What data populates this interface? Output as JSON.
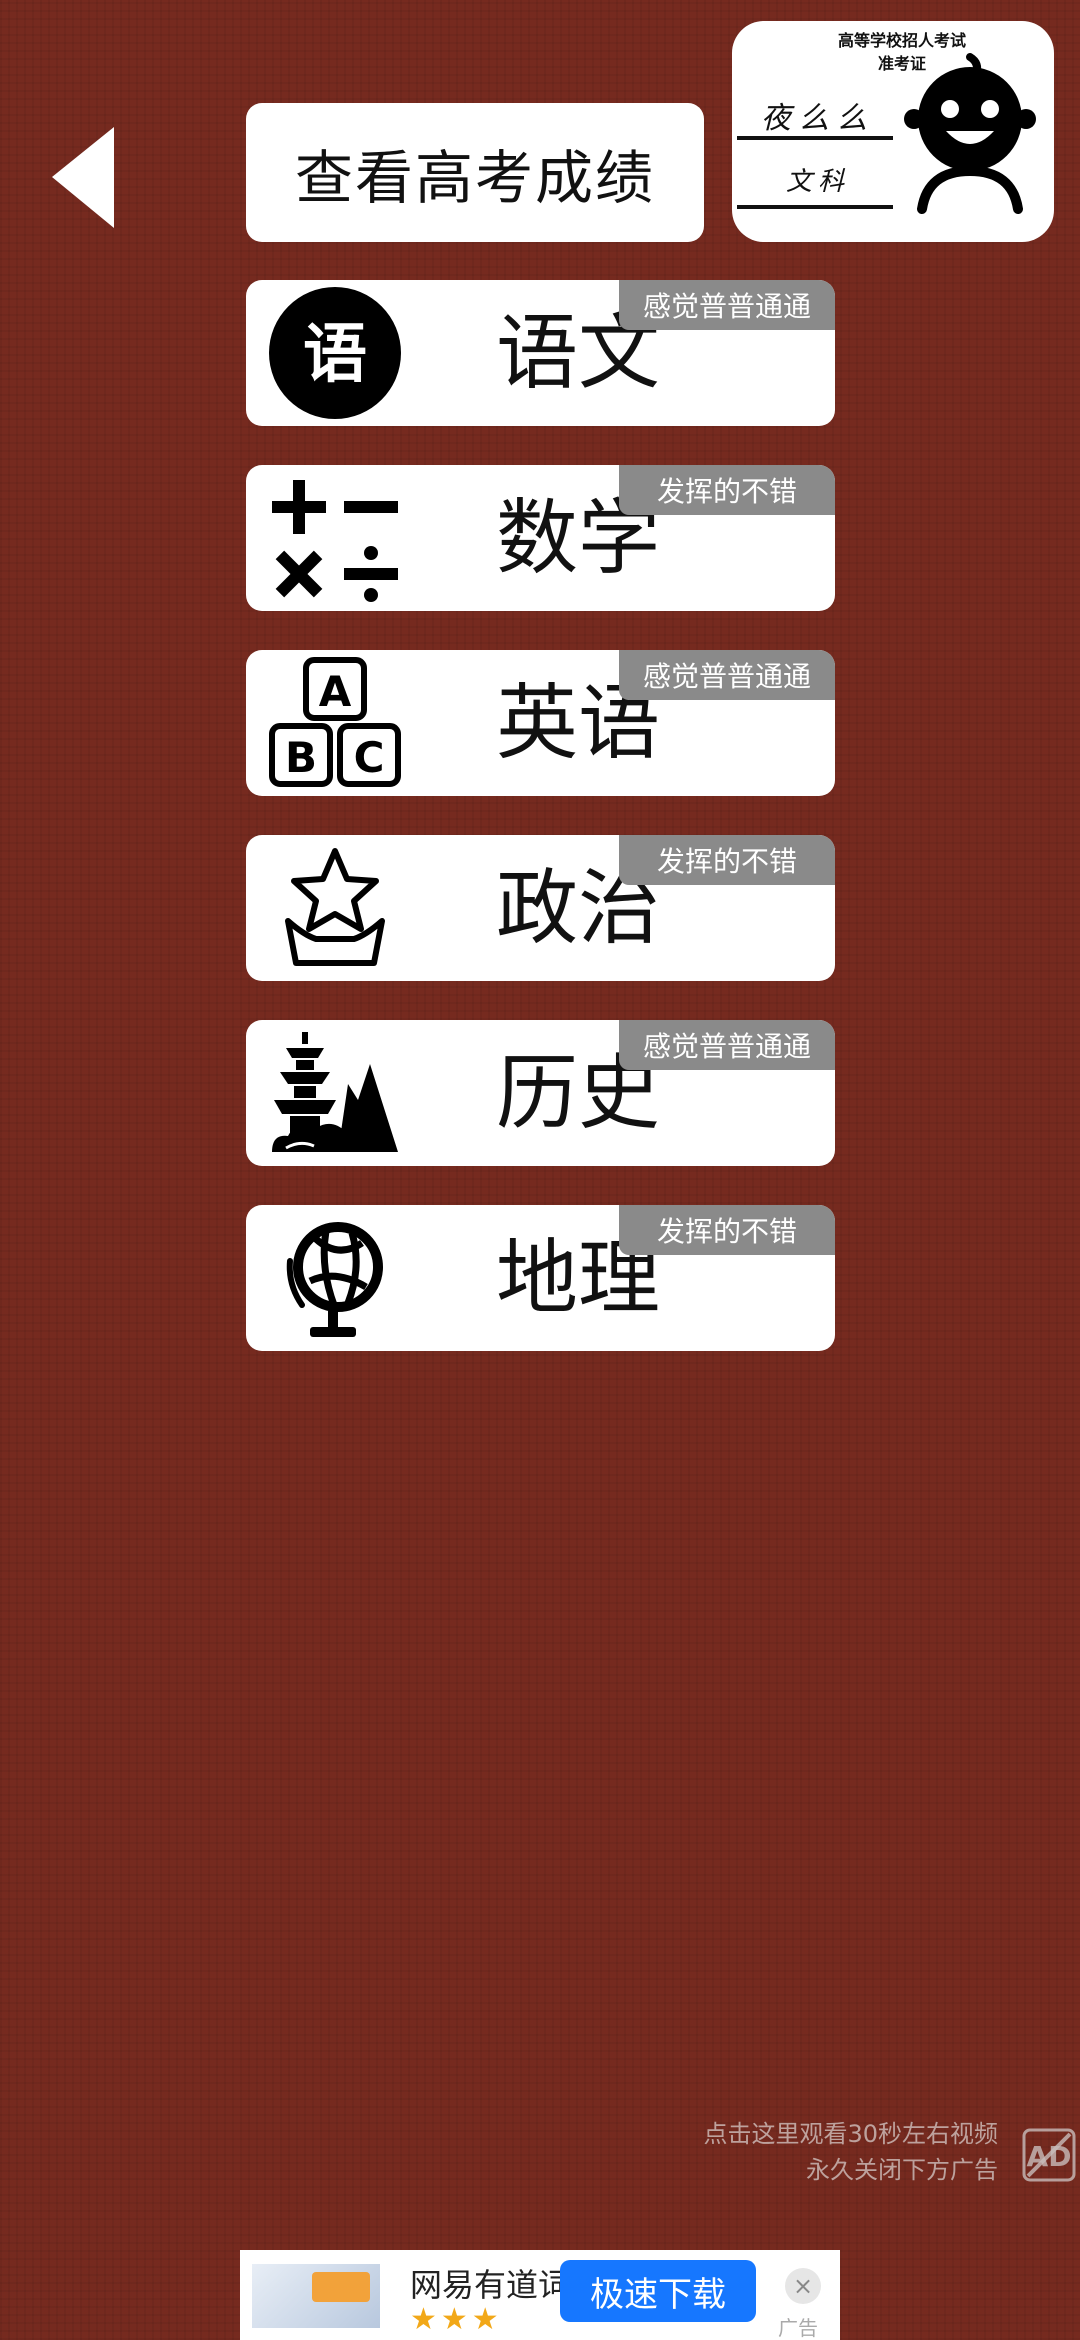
{
  "header": {
    "title": "查看高考成绩"
  },
  "ticket": {
    "org_line1": "高等学校招人考试",
    "org_line2": "准考证",
    "name": "夜么么",
    "subject": "文科"
  },
  "subjects": [
    {
      "label": "语文",
      "tag": "感觉普普通通",
      "icon": "yu-character-icon"
    },
    {
      "label": "数学",
      "tag": "发挥的不错",
      "icon": "math-symbols-icon"
    },
    {
      "label": "英语",
      "tag": "感觉普普通通",
      "icon": "abc-blocks-icon"
    },
    {
      "label": "政治",
      "tag": "发挥的不错",
      "icon": "star-podium-icon"
    },
    {
      "label": "历史",
      "tag": "感觉普普通通",
      "icon": "pagoda-icon"
    },
    {
      "label": "地理",
      "tag": "发挥的不错",
      "icon": "globe-icon"
    }
  ],
  "ad_hint": {
    "line1": "点击这里观看30秒左右视频",
    "line2": "永久关闭下方广告"
  },
  "banner": {
    "title": "网易有道词",
    "download_label": "极速下载",
    "ad_mark": "广告",
    "close": "×",
    "stars": "★★★"
  },
  "colors": {
    "background": "#762a1f",
    "tag_bg": "#8a8a8a",
    "download_btn": "#1677ff"
  }
}
